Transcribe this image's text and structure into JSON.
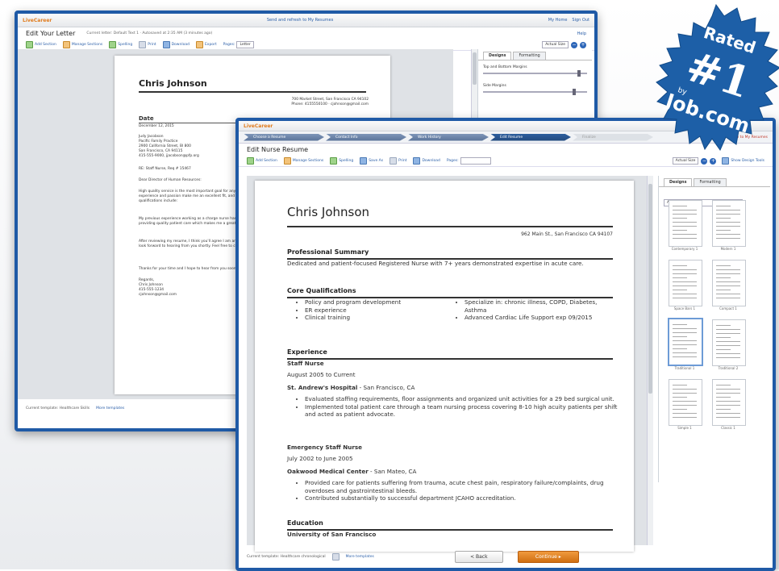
{
  "back_window": {
    "logo": "LiveCareer",
    "center_link": "Send and refresh to My Resumes",
    "top_links": [
      "My Home",
      "Sign Out"
    ],
    "title": "Edit Your Letter",
    "subtitle": "Current letter: Default Text 1 · Autosaved at 2:35 AM (3 minutes ago)",
    "help": "Help",
    "toolbar": [
      "Add Section",
      "Manage Sections",
      "Spelling",
      "Print",
      "Download",
      "Export",
      "Pages:"
    ],
    "pages_value": "Letter",
    "zoom_value": "Actual Size",
    "side_tabs": [
      "Designs",
      "Formatting"
    ],
    "side_labels": [
      "Top and Bottom Margins",
      "Side Margins"
    ],
    "letter": {
      "name": "Chris Johnson",
      "address": "700 Market Street, San Francisco CA 94102",
      "contact": "Phone: 4155550100 · cjohnson@gmail.com",
      "date_heading": "Date",
      "date": "December 12, 2015",
      "recipient": [
        "Judy Jacobson",
        "Pacific Family Practice",
        "2900 California Street, Bl 800",
        "San Francisco, CA 94115",
        "415-555-9000, jjacobson@pfp.org"
      ],
      "re": "RE: Staff Nurse, Req # 15467",
      "salutation": "Dear Director of Human Resources:",
      "p1": "High quality service is the most important goal for any healthcare provider. As you can see from my resume, my years of experience and passion make me an excellent fit, and I am eager to bring my skills to Pacific Family Practice. My key qualifications include:",
      "p2": "My previous experience working as a charge nurse has given me valuable experience. I have an excellent track record of providing quality patient care which makes me a great addition to your team.",
      "p3": "After reviewing my resume, I think you'll agree I am an excellent fit for your hospital. I am certain I can add value at once. I look forward to hearing from you shortly. Feel free to contact me before my next interview.",
      "closing": "Thanks for your time and I hope to hear from you soon.",
      "regards": [
        "Regards,",
        "Chris Johnson",
        "415-555-1234",
        "cjohnson@gmail.com"
      ]
    },
    "bottom_template": "Current template: Healthcare Skills",
    "bottom_link": "More templates"
  },
  "front_window": {
    "logo": "LiveCareer",
    "steps": [
      "Choose a Resume",
      "Contact Info",
      "Work History",
      "Edit Resume",
      "Finalize"
    ],
    "center_link": "Save and refresh to My Resumes",
    "title": "Edit Nurse Resume",
    "toolbar": [
      "Add Section",
      "Manage Sections",
      "Spelling",
      "Save As",
      "Print",
      "Download",
      "Pages:"
    ],
    "zoom_value": "Actual Size",
    "design_tools": "Show Design Tools",
    "side_tabs": [
      "Designs",
      "Formatting"
    ],
    "designs_filter": "All Designs",
    "thumb_labels": [
      "Contemporary 1",
      "Modern 1",
      "Space Bars 1",
      "Compact 1",
      "Traditional 1",
      "Traditional 2",
      "Simple 1",
      "Classic 1"
    ],
    "resume": {
      "name": "Chris Johnson",
      "address": "962 Main St., San Francisco CA 94107",
      "summary_heading": "Professional Summary",
      "summary": "Dedicated and patient-focused Registered Nurse with 7+ years demonstrated expertise in acute care.",
      "core_heading": "Core Qualifications",
      "core_left": [
        "Policy and program development",
        "ER experience",
        "Clinical training"
      ],
      "core_right": [
        "Specialize in: chronic illness, COPD, Diabetes, Asthma",
        "Advanced Cardiac Life Support exp 09/2015"
      ],
      "exp_heading": "Experience",
      "job1_title": "Staff Nurse",
      "job1_dates": "August 2005 to Current",
      "job1_employer": "St. Andrew's Hospital",
      "job1_location": " - San Francisco, CA",
      "job1_bullets": [
        "Evaluated staffing requirements, floor assignments and organized unit activities for a 29 bed surgical unit.",
        "Implemented total patient care through a team nursing process covering 8-10 high acuity patients per shift and acted as patient advocate."
      ],
      "job2_title": "Emergency Staff Nurse",
      "job2_dates": "July 2002 to June 2005",
      "job2_employer": "Oakwood Medical Center",
      "job2_location": " - San Mateo, CA",
      "job2_bullets": [
        "Provided care for patients suffering from trauma, acute chest pain, respiratory failure/complaints, drug overdoses and gastrointestinal bleeds.",
        "Contributed substantially to successful department JCAHO accreditation."
      ],
      "edu_heading": "Education",
      "edu_school": "University of San Francisco"
    },
    "bottom_template": "Current template: Healthcare chronological",
    "bottom_link": "More templates",
    "back_button": "< Back",
    "continue_button": "Continue ▸"
  },
  "badge": {
    "rated": "Rated",
    "rank": "#1",
    "by": "by",
    "site": "Job.com"
  },
  "colors": {
    "window_border": "#1f5aa6",
    "badge": "#1d5fa7",
    "continue": "#e07c1f"
  }
}
